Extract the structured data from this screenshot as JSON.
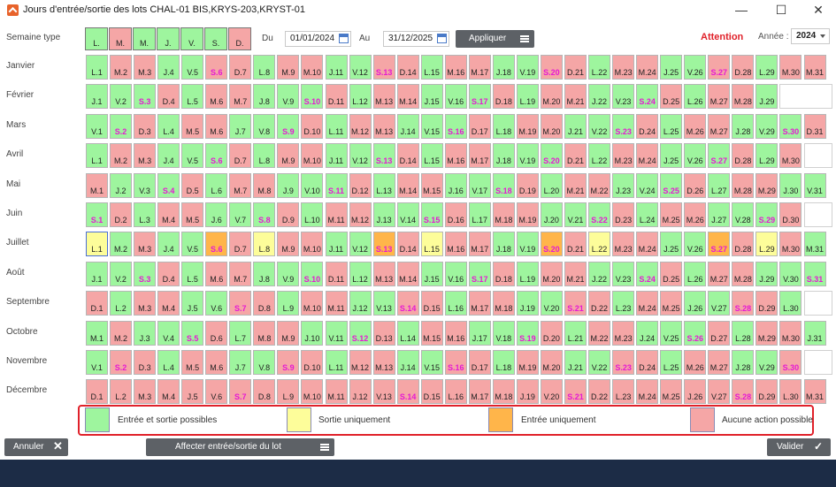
{
  "window": {
    "title": "Jours d'entrée/sortie des lots CHAL-01 BIS,KRYS-203,KRYST-01",
    "minimize": "—",
    "maximize": "☐",
    "close": "✕"
  },
  "toolbar": {
    "week_type_label": "Semaine type",
    "week_type": [
      "L.",
      "M.",
      "M.",
      "J.",
      "V.",
      "S.",
      "D."
    ],
    "week_type_states": [
      "E",
      "X",
      "E",
      "E",
      "E",
      "E",
      "X"
    ],
    "from_label": "Du",
    "from_date": "01/01/2024",
    "to_label": "Au",
    "to_date": "31/12/2025",
    "apply_label": "Appliquer",
    "attention_label": "Attention",
    "year_label": "Année :",
    "year_value": "2024"
  },
  "months": [
    {
      "name": "Janvier",
      "days": [
        "L.1",
        "M.2",
        "M.3",
        "J.4",
        "V.5",
        "S.6",
        "D.7",
        "L.8",
        "M.9",
        "M.10",
        "J.11",
        "V.12",
        "S.13",
        "D.14",
        "L.15",
        "M.16",
        "M.17",
        "J.18",
        "V.19",
        "S.20",
        "D.21",
        "L.22",
        "M.23",
        "M.24",
        "J.25",
        "V.26",
        "S.27",
        "D.28",
        "L.29",
        "M.30",
        "M.31"
      ],
      "states": "EXXEEXXEXXEEXXEXXEEXXEXXEEXXEXX"
    },
    {
      "name": "Février",
      "days": [
        "J.1",
        "V.2",
        "S.3",
        "D.4",
        "L.5",
        "M.6",
        "M.7",
        "J.8",
        "V.9",
        "S.10",
        "D.11",
        "L.12",
        "M.13",
        "M.14",
        "J.15",
        "V.16",
        "S.17",
        "D.18",
        "L.19",
        "M.20",
        "M.21",
        "J.22",
        "V.23",
        "S.24",
        "D.25",
        "L.26",
        "M.27",
        "M.28",
        "J.29"
      ],
      "states": "EEEXEXXEEEXEXXEEEXEXXEEEXEXXE"
    },
    {
      "name": "Mars",
      "days": [
        "V.1",
        "S.2",
        "D.3",
        "L.4",
        "M.5",
        "M.6",
        "J.7",
        "V.8",
        "S.9",
        "D.10",
        "L.11",
        "M.12",
        "M.13",
        "J.14",
        "V.15",
        "S.16",
        "D.17",
        "L.18",
        "M.19",
        "M.20",
        "J.21",
        "V.22",
        "S.23",
        "D.24",
        "L.25",
        "M.26",
        "M.27",
        "J.28",
        "V.29",
        "S.30",
        "D.31"
      ],
      "states": "EEXEXXEEEXEXXEEEXEXXEEEXEXXEEEX"
    },
    {
      "name": "Avril",
      "days": [
        "L.1",
        "M.2",
        "M.3",
        "J.4",
        "V.5",
        "S.6",
        "D.7",
        "L.8",
        "M.9",
        "M.10",
        "J.11",
        "V.12",
        "S.13",
        "D.14",
        "L.15",
        "M.16",
        "M.17",
        "J.18",
        "V.19",
        "S.20",
        "D.21",
        "L.22",
        "M.23",
        "M.24",
        "J.25",
        "V.26",
        "S.27",
        "D.28",
        "L.29",
        "M.30"
      ],
      "states": "EXXEEEXEXXEEEXEXXEEEXEXXEEEXEX"
    },
    {
      "name": "Mai",
      "days": [
        "M.1",
        "J.2",
        "V.3",
        "S.4",
        "D.5",
        "L.6",
        "M.7",
        "M.8",
        "J.9",
        "V.10",
        "S.11",
        "D.12",
        "L.13",
        "M.14",
        "M.15",
        "J.16",
        "V.17",
        "S.18",
        "D.19",
        "L.20",
        "M.21",
        "M.22",
        "J.23",
        "V.24",
        "S.25",
        "D.26",
        "L.27",
        "M.28",
        "M.29",
        "J.30",
        "V.31"
      ],
      "states": "XEEEXEXXEEEXEXXEEEXEXXEEEXEXXEE"
    },
    {
      "name": "Juin",
      "days": [
        "S.1",
        "D.2",
        "L.3",
        "M.4",
        "M.5",
        "J.6",
        "V.7",
        "S.8",
        "D.9",
        "L.10",
        "M.11",
        "M.12",
        "J.13",
        "V.14",
        "S.15",
        "D.16",
        "L.17",
        "M.18",
        "M.19",
        "J.20",
        "V.21",
        "S.22",
        "D.23",
        "L.24",
        "M.25",
        "M.26",
        "J.27",
        "V.28",
        "S.29",
        "D.30"
      ],
      "states": "EXEXXEEEXEXXEEEXEXXEEEXEXXEEEX"
    },
    {
      "name": "Juillet",
      "days": [
        "L.1",
        "M.2",
        "M.3",
        "J.4",
        "V.5",
        "S.6",
        "D.7",
        "L.8",
        "M.9",
        "M.10",
        "J.11",
        "V.12",
        "S.13",
        "D.14",
        "L.15",
        "M.16",
        "M.17",
        "J.18",
        "V.19",
        "S.20",
        "D.21",
        "L.22",
        "M.23",
        "M.24",
        "J.25",
        "V.26",
        "S.27",
        "D.28",
        "L.29",
        "M.30",
        "M.31"
      ],
      "states": "SEXEEIXSXXEEIXSXXEEIXSXXEEIXSXE"
    },
    {
      "name": "Août",
      "days": [
        "J.1",
        "V.2",
        "S.3",
        "D.4",
        "L.5",
        "M.6",
        "M.7",
        "J.8",
        "V.9",
        "S.10",
        "D.11",
        "L.12",
        "M.13",
        "M.14",
        "J.15",
        "V.16",
        "S.17",
        "D.18",
        "L.19",
        "M.20",
        "M.21",
        "J.22",
        "V.23",
        "S.24",
        "D.25",
        "L.26",
        "M.27",
        "M.28",
        "J.29",
        "V.30",
        "S.31"
      ],
      "states": "EEEXEXXEEEXEXXEEEXEXXEEEXEXXEEE"
    },
    {
      "name": "Septembre",
      "days": [
        "D.1",
        "L.2",
        "M.3",
        "M.4",
        "J.5",
        "V.6",
        "S.7",
        "D.8",
        "L.9",
        "M.10",
        "M.11",
        "J.12",
        "V.13",
        "S.14",
        "D.15",
        "L.16",
        "M.17",
        "M.18",
        "J.19",
        "V.20",
        "S.21",
        "D.22",
        "L.23",
        "M.24",
        "M.25",
        "J.26",
        "V.27",
        "S.28",
        "D.29",
        "L.30"
      ],
      "states": "XEXXEEXXEXXEEXXEXXEEXXEXXEEXXE"
    },
    {
      "name": "Octobre",
      "days": [
        "M.1",
        "M.2",
        "J.3",
        "V.4",
        "S.5",
        "D.6",
        "L.7",
        "M.8",
        "M.9",
        "J.10",
        "V.11",
        "S.12",
        "D.13",
        "L.14",
        "M.15",
        "M.16",
        "J.17",
        "V.18",
        "S.19",
        "D.20",
        "L.21",
        "M.22",
        "M.23",
        "J.24",
        "V.25",
        "S.26",
        "D.27",
        "L.28",
        "M.29",
        "M.30",
        "J.31"
      ],
      "states": "EXEEEXEXXEEEXEXXEEEXEXXEEEXEXXE"
    },
    {
      "name": "Novembre",
      "days": [
        "V.1",
        "S.2",
        "D.3",
        "L.4",
        "M.5",
        "M.6",
        "J.7",
        "V.8",
        "S.9",
        "D.10",
        "L.11",
        "M.12",
        "M.13",
        "J.14",
        "V.15",
        "S.16",
        "D.17",
        "L.18",
        "M.19",
        "M.20",
        "J.21",
        "V.22",
        "S.23",
        "D.24",
        "L.25",
        "M.26",
        "M.27",
        "J.28",
        "V.29",
        "S.30"
      ],
      "states": "EXXEXXEEXXEXXEEXXEXXEEXXEXXEEX"
    },
    {
      "name": "Décembre",
      "days": [
        "D.1",
        "L.2",
        "M.3",
        "M.4",
        "J.5",
        "V.6",
        "S.7",
        "D.8",
        "L.9",
        "M.10",
        "M.11",
        "J.12",
        "V.13",
        "S.14",
        "D.15",
        "L.16",
        "M.17",
        "M.18",
        "J.19",
        "V.20",
        "S.21",
        "D.22",
        "L.23",
        "M.24",
        "M.25",
        "J.26",
        "V.27",
        "S.28",
        "D.29",
        "L.30",
        "M.31"
      ],
      "states": "XXXXXXXXXXXXXXXXXXXXXXXXXXXXXXX"
    }
  ],
  "legend": [
    {
      "state": "E",
      "label": "Entrée et sortie possibles"
    },
    {
      "state": "S",
      "label": "Sortie uniquement"
    },
    {
      "state": "I",
      "label": "Entrée uniquement"
    },
    {
      "state": "X",
      "label": "Aucune action possible"
    }
  ],
  "footer": {
    "cancel_label": "Annuler",
    "assign_label": "Affecter entrée/sortie du lot",
    "validate_label": "Valider"
  },
  "colors": {
    "E": "#9ef59e",
    "X": "#f5a6a6",
    "S": "#fdfd9a",
    "I": "#ffb54a",
    "weekend_text": "#e619d3",
    "attention": "#e0212a"
  }
}
